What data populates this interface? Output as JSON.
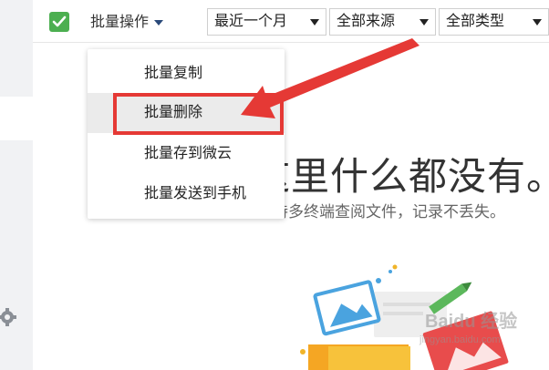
{
  "toolbar": {
    "batch_label": "批量操作",
    "filters": [
      {
        "value": "最近一个月"
      },
      {
        "value": "全部来源"
      },
      {
        "value": "全部类型"
      }
    ]
  },
  "menu": {
    "items": [
      {
        "label": "批量复制"
      },
      {
        "label": "批量删除"
      },
      {
        "label": "批量存到微云"
      },
      {
        "label": "批量发送到手机"
      }
    ]
  },
  "empty": {
    "title": "这里什么都没有。",
    "subtitle": "支持多终端查阅文件，记录不丢失。"
  },
  "watermark": {
    "brand": "Baidu 经验",
    "url": "jingyan.baidu.com"
  },
  "colors": {
    "accent_green": "#4caf50",
    "annotation_red": "#e53935",
    "sidebar_bg": "#f1f2f4"
  },
  "icons": [
    "check-icon",
    "gear-icon",
    "caret-down-icon",
    "arrow-annotation"
  ]
}
